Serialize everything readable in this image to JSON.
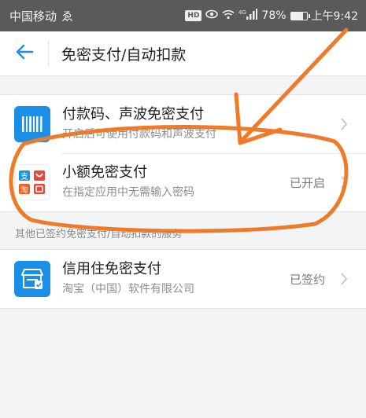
{
  "status_bar": {
    "carrier": "中国移动",
    "carrier_extra": "ゑ",
    "hd_badge": "HD",
    "signal_label": "4G",
    "battery_text": "78%",
    "battery_level": 0.78,
    "time": "上午9:42"
  },
  "nav": {
    "title": "免密支付/自动扣款"
  },
  "group1": {
    "items": [
      {
        "title": "付款码、声波免密支付",
        "subtitle": "开启后可使用付款码和声波支付",
        "status": "",
        "icon": "barcode-icon",
        "icon_color": "#1b8fe6"
      },
      {
        "title": "小额免密支付",
        "subtitle": "在指定应用中无需输入密码",
        "status": "已开启",
        "icon": "small-payment-apps-icon",
        "icon_color": "#ffffff"
      }
    ]
  },
  "section_label": "其他已签约免密支付/自动扣款的服务",
  "group2": {
    "items": [
      {
        "title": "信用住免密支付",
        "subtitle": "淘宝（中国）软件有限公司",
        "status": "已签约",
        "icon": "credit-stay-icon",
        "icon_color": "#1b8fe6"
      }
    ]
  },
  "annotation": {
    "color": "#ef7a2a"
  }
}
